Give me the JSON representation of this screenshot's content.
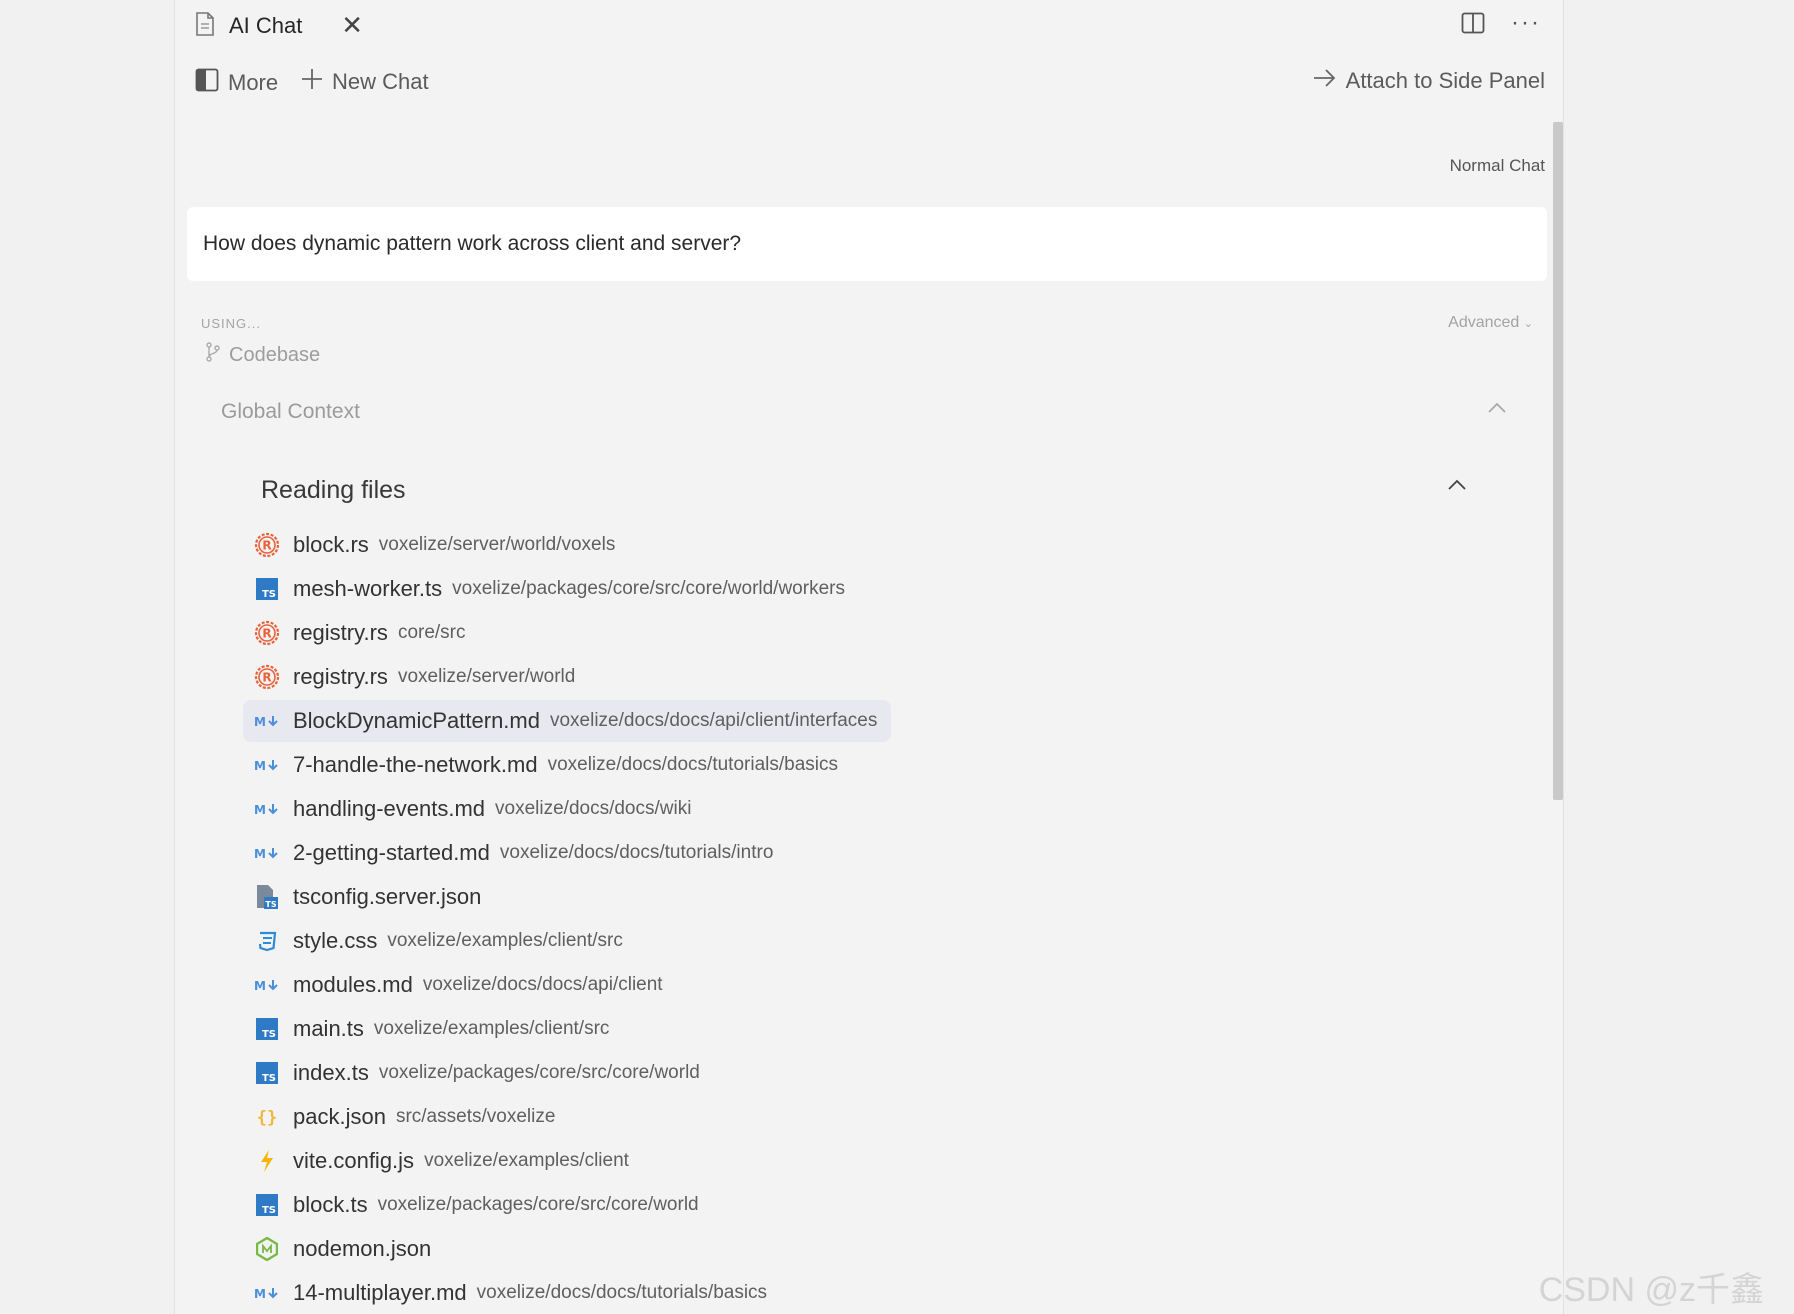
{
  "tab": {
    "title": "AI Chat"
  },
  "toolbar": {
    "more": "More",
    "new_chat": "New Chat",
    "attach": "Attach to Side Panel"
  },
  "chat": {
    "mode": "Normal Chat",
    "question": "How does dynamic pattern work across client and server?",
    "using_label": "USING...",
    "advanced_label": "Advanced",
    "codebase_label": "Codebase"
  },
  "context": {
    "title": "Global Context",
    "reading_title": "Reading files",
    "files": [
      {
        "name": "block.rs",
        "path": "voxelize/server/world/voxels",
        "icon": "rust-icon"
      },
      {
        "name": "mesh-worker.ts",
        "path": "voxelize/packages/core/src/core/world/workers",
        "icon": "typescript-icon"
      },
      {
        "name": "registry.rs",
        "path": "core/src",
        "icon": "rust-icon"
      },
      {
        "name": "registry.rs",
        "path": "voxelize/server/world",
        "icon": "rust-icon"
      },
      {
        "name": "BlockDynamicPattern.md",
        "path": "voxelize/docs/docs/api/client/interfaces",
        "icon": "markdown-icon",
        "highlighted": true
      },
      {
        "name": "7-handle-the-network.md",
        "path": "voxelize/docs/docs/tutorials/basics",
        "icon": "markdown-icon"
      },
      {
        "name": "handling-events.md",
        "path": "voxelize/docs/docs/wiki",
        "icon": "markdown-icon"
      },
      {
        "name": "2-getting-started.md",
        "path": "voxelize/docs/docs/tutorials/intro",
        "icon": "markdown-icon"
      },
      {
        "name": "tsconfig.server.json",
        "path": "",
        "icon": "tsconfig-icon"
      },
      {
        "name": "style.css",
        "path": "voxelize/examples/client/src",
        "icon": "css-icon"
      },
      {
        "name": "modules.md",
        "path": "voxelize/docs/docs/api/client",
        "icon": "markdown-icon"
      },
      {
        "name": "main.ts",
        "path": "voxelize/examples/client/src",
        "icon": "typescript-icon"
      },
      {
        "name": "index.ts",
        "path": "voxelize/packages/core/src/core/world",
        "icon": "typescript-icon"
      },
      {
        "name": "pack.json",
        "path": "src/assets/voxelize",
        "icon": "json-icon"
      },
      {
        "name": "vite.config.js",
        "path": "voxelize/examples/client",
        "icon": "vite-icon"
      },
      {
        "name": "block.ts",
        "path": "voxelize/packages/core/src/core/world",
        "icon": "typescript-icon"
      },
      {
        "name": "nodemon.json",
        "path": "",
        "icon": "nodemon-icon"
      },
      {
        "name": "14-multiplayer.md",
        "path": "voxelize/docs/docs/tutorials/basics",
        "icon": "markdown-icon"
      }
    ]
  },
  "watermark": "CSDN @z千鑫",
  "colors": {
    "rust": "#e8623b",
    "typescript": "#2f7ac4",
    "markdown": "#4b8fd9",
    "json": "#f0b73b",
    "vite": "#f4b400",
    "nodemon": "#76b947"
  }
}
